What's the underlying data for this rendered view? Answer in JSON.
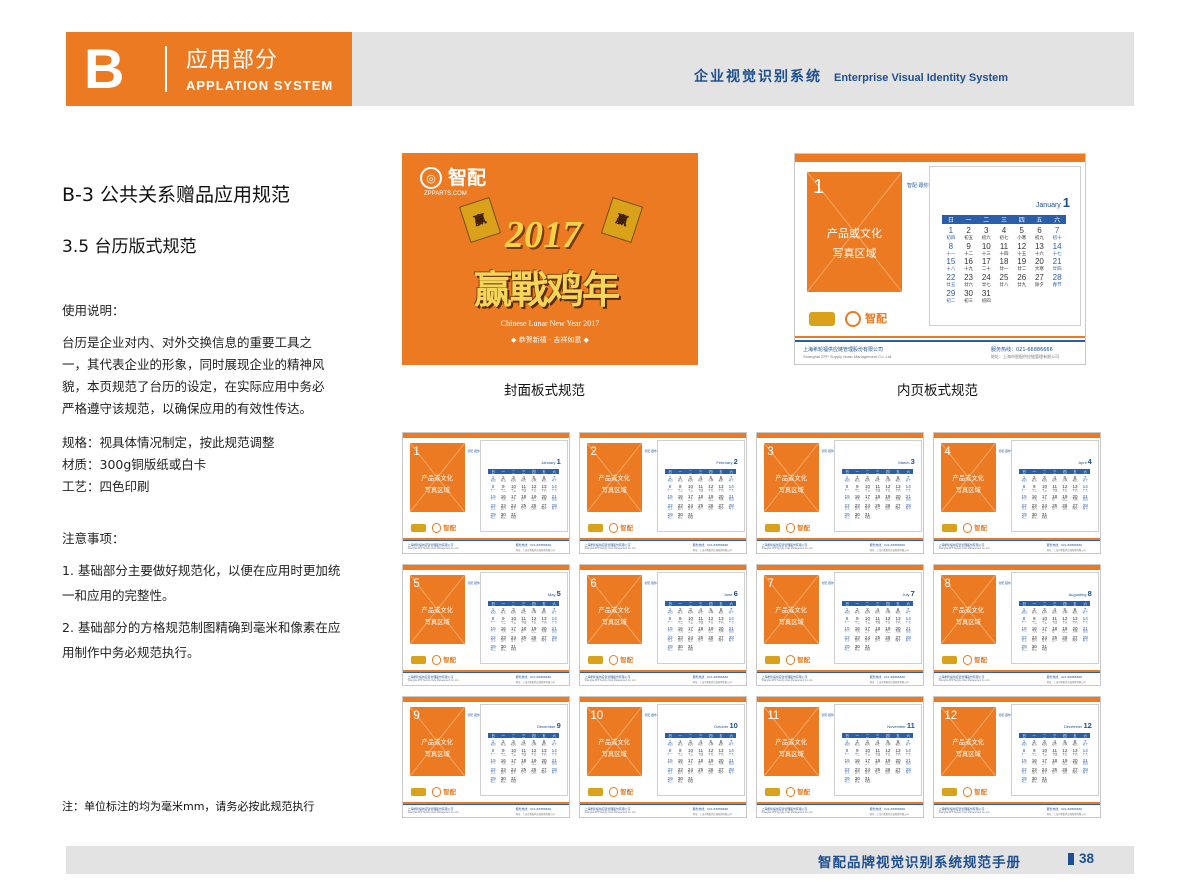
{
  "header": {
    "letter": "B",
    "section_cn": "应用部分",
    "section_en": "APPLATION SYSTEM",
    "system_cn": "企业视觉识别系统",
    "system_en": "Enterprise Visual Identity System"
  },
  "content": {
    "title": "B-3  公共关系赠品应用规范",
    "subtitle": "3.5 台历版式规范",
    "usage_heading": "使用说明：",
    "usage_text": "台历是企业对内、对外交换信息的重要工具之一，其代表企业的形象，同时展现企业的精神风貌，本页规范了台历的设定，在实际应用中务必严格遵守该规范，以确保应用的有效性传达。",
    "specs": [
      "规格：视具体情况制定，按此规范调整",
      "材质：300g铜版纸或白卡",
      "工艺：四色印刷"
    ],
    "notes_heading": "注意事项：",
    "notes": [
      "1. 基础部分主要做好规范化，以便在应用时更加统一和应用的完整性。",
      "2. 基础部分的方格规范制图精确到毫米和像素在应用制作中务必规范执行。"
    ],
    "footnote": "注：单位标注的均为毫米mm，请务必按此规范执行"
  },
  "cover": {
    "brand": "智配",
    "brand_en": "ZPPARTS.COM",
    "year": "2017",
    "flag_char": "赢",
    "slogan": "赢戰鸡年",
    "lunar": "Chinese Lunar New Year 2017",
    "greeting": "◆ 恭贺新禧 · 吉祥如意 ◆",
    "caption": "封面板式规范"
  },
  "inner": {
    "photo_label_1": "产品或文化",
    "photo_label_2": "写真区域",
    "company_cn": "智配·跟你而配",
    "company_full": "上海希轮福供应链管理股份有限公司",
    "company_full_en": "Shanghai ZPP Supply chain Management Co.,Ltd.",
    "phone": "服务热线：021-66886666",
    "address": "地址：上海市智配供应链管理有限公司",
    "weekdays": [
      "日",
      "一",
      "二",
      "三",
      "四",
      "五",
      "六"
    ],
    "caption": "内页板式规范"
  },
  "months": [
    {
      "n": "1",
      "name": "January"
    },
    {
      "n": "2",
      "name": "February"
    },
    {
      "n": "3",
      "name": "March"
    },
    {
      "n": "4",
      "name": "April"
    },
    {
      "n": "5",
      "name": "May"
    },
    {
      "n": "6",
      "name": "June"
    },
    {
      "n": "7",
      "name": "July"
    },
    {
      "n": "8",
      "name": "Augusting"
    },
    {
      "n": "9",
      "name": "December"
    },
    {
      "n": "10",
      "name": "October"
    },
    {
      "n": "11",
      "name": "November"
    },
    {
      "n": "12",
      "name": "December"
    }
  ],
  "january_days": [
    [
      {
        "d": "1",
        "l": "初四"
      },
      {
        "d": "2",
        "l": "初五"
      },
      {
        "d": "3",
        "l": "初六"
      },
      {
        "d": "4",
        "l": "初七"
      },
      {
        "d": "5",
        "l": "小寒"
      },
      {
        "d": "6",
        "l": "初九"
      },
      {
        "d": "7",
        "l": "初十"
      }
    ],
    [
      {
        "d": "8",
        "l": "十一"
      },
      {
        "d": "9",
        "l": "十二"
      },
      {
        "d": "10",
        "l": "十三"
      },
      {
        "d": "11",
        "l": "十四"
      },
      {
        "d": "12",
        "l": "十五"
      },
      {
        "d": "13",
        "l": "十六"
      },
      {
        "d": "14",
        "l": "十七"
      }
    ],
    [
      {
        "d": "15",
        "l": "十八"
      },
      {
        "d": "16",
        "l": "十九"
      },
      {
        "d": "17",
        "l": "二十"
      },
      {
        "d": "18",
        "l": "廿一"
      },
      {
        "d": "19",
        "l": "廿二"
      },
      {
        "d": "20",
        "l": "大寒"
      },
      {
        "d": "21",
        "l": "廿四"
      }
    ],
    [
      {
        "d": "22",
        "l": "廿五"
      },
      {
        "d": "23",
        "l": "廿六"
      },
      {
        "d": "24",
        "l": "廿七"
      },
      {
        "d": "25",
        "l": "廿八"
      },
      {
        "d": "26",
        "l": "廿九"
      },
      {
        "d": "27",
        "l": "除夕"
      },
      {
        "d": "28",
        "l": "春节"
      }
    ],
    [
      {
        "d": "29",
        "l": "初二"
      },
      {
        "d": "30",
        "l": "初三"
      },
      {
        "d": "31",
        "l": "初四"
      },
      {
        "d": "",
        "l": ""
      },
      {
        "d": "",
        "l": ""
      },
      {
        "d": "",
        "l": ""
      },
      {
        "d": "",
        "l": ""
      }
    ]
  ],
  "footer": {
    "title": "智配品牌视觉识别系统规范手册",
    "page": "38"
  },
  "colors": {
    "orange": "#ec7a22",
    "blue": "#1d4f91",
    "gray": "#e3e3e4"
  }
}
